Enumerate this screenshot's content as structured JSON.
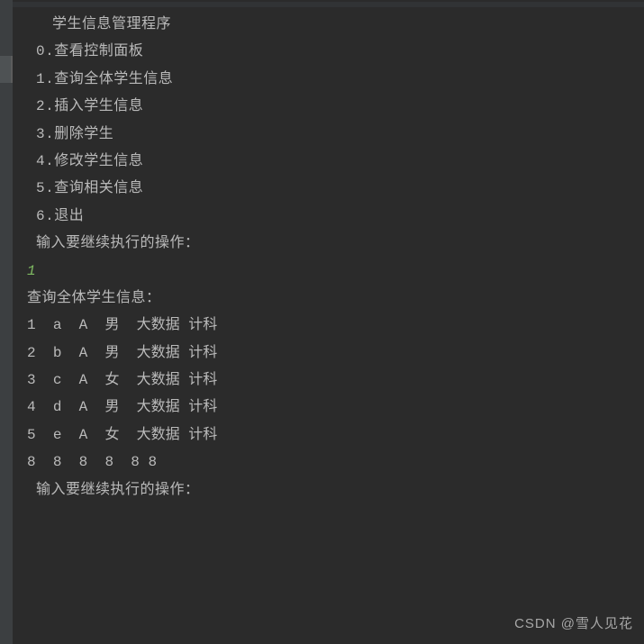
{
  "title": "学生信息管理程序",
  "menu": [
    {
      "num": "0",
      "label": "查看控制面板"
    },
    {
      "num": "1",
      "label": "查询全体学生信息"
    },
    {
      "num": "2",
      "label": "插入学生信息"
    },
    {
      "num": "3",
      "label": "删除学生"
    },
    {
      "num": "4",
      "label": "修改学生信息"
    },
    {
      "num": "5",
      "label": "查询相关信息"
    },
    {
      "num": "6",
      "label": "退出"
    }
  ],
  "prompt1": "输入要继续执行的操作：",
  "input1": "1",
  "query_header": "查询全体学生信息：",
  "rows": [
    [
      "1",
      "a",
      "A",
      "男",
      "大数据",
      "计科"
    ],
    [
      "2",
      "b",
      "A",
      "男",
      "大数据",
      "计科"
    ],
    [
      "3",
      "c",
      "A",
      "女",
      "大数据",
      "计科"
    ],
    [
      "4",
      "d",
      "A",
      "男",
      "大数据",
      "计科"
    ],
    [
      "5",
      "e",
      "A",
      "女",
      "大数据",
      "计科"
    ],
    [
      "8",
      "8",
      "8",
      "8",
      "8 8",
      ""
    ]
  ],
  "prompt2": "输入要继续执行的操作：",
  "watermark": "CSDN @雪人见花"
}
